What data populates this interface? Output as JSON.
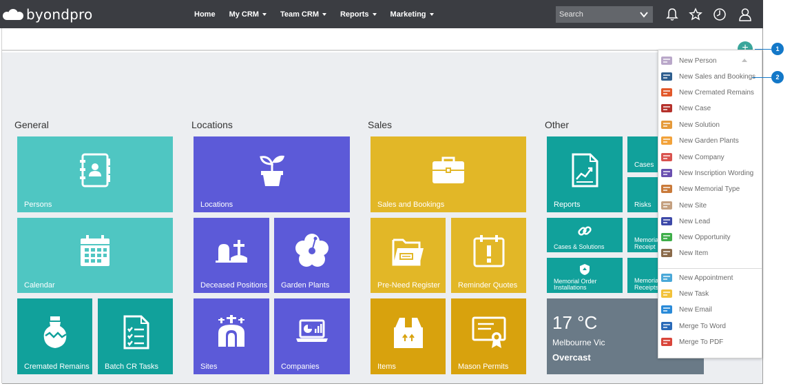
{
  "brand": {
    "name": "byondpro"
  },
  "nav": {
    "items": [
      {
        "label": "Home",
        "dropdown": false
      },
      {
        "label": "My CRM",
        "dropdown": true
      },
      {
        "label": "Team CRM",
        "dropdown": true
      },
      {
        "label": "Reports",
        "dropdown": true
      },
      {
        "label": "Marketing",
        "dropdown": true
      }
    ],
    "search_placeholder": "Search"
  },
  "groups": {
    "general": "General",
    "locations": "Locations",
    "sales": "Sales",
    "other": "Other"
  },
  "tiles": {
    "persons": "Persons",
    "calendar": "Calendar",
    "cremated_remains": "Cremated Remains",
    "batch_cr_tasks": "Batch CR Tasks",
    "locations": "Locations",
    "deceased_positions": "Deceased Positions",
    "garden_plants": "Garden Plants",
    "sites": "Sites",
    "companies": "Companies",
    "sales_bookings": "Sales and Bookings",
    "pre_need_register": "Pre-Need Register",
    "reminder_quotes": "Reminder Quotes",
    "items": "Items",
    "mason_permits": "Mason Permits",
    "reports": "Reports",
    "cases": "Cases",
    "risks": "Risks",
    "cases_solutions": "Cases & Solutions",
    "memorial_receipt_1": "Memorial Receipt",
    "memorial_order_line1": "Memorial Order",
    "memorial_order_line2": "Installations",
    "memorial_receipt_2": "Memorial Receipts"
  },
  "weather": {
    "temp": "17 °C",
    "city": "Melbourne Vic",
    "condition": "Overcast"
  },
  "add_button": {
    "label": "+"
  },
  "dropdown": {
    "items": [
      {
        "label": "New Person",
        "icon": "person-card-icon",
        "color": "#b9a7c9"
      },
      {
        "label": "New Sales and Bookings",
        "icon": "briefcase-icon",
        "color": "#2f5f8f"
      },
      {
        "label": "New Cremated Remains",
        "icon": "urn-icon",
        "color": "#e2582a"
      },
      {
        "label": "New Case",
        "icon": "case-binders-icon",
        "color": "#b5322c"
      },
      {
        "label": "New Solution",
        "icon": "solution-blocks-icon",
        "color": "#e59a3a"
      },
      {
        "label": "New Garden Plants",
        "icon": "flower-icon",
        "color": "#f2a23a"
      },
      {
        "label": "New Company",
        "icon": "company-card-icon",
        "color": "#d9534f"
      },
      {
        "label": "New Inscription Wording",
        "icon": "quote-icon",
        "color": "#6a4fb0"
      },
      {
        "label": "New Memorial Type",
        "icon": "memorial-icon",
        "color": "#c97a3a"
      },
      {
        "label": "New Site",
        "icon": "church-icon",
        "color": "#c4a080"
      },
      {
        "label": "New Lead",
        "icon": "lead-card-icon",
        "color": "#3d49a8"
      },
      {
        "label": "New Opportunity",
        "icon": "opportunity-icon",
        "color": "#3fae4a"
      },
      {
        "label": "New Item",
        "icon": "item-box-icon",
        "color": "#8a6a4a"
      },
      {
        "label": "New Appointment",
        "icon": "appointment-icon",
        "color": "#4aa8d8"
      },
      {
        "label": "New Task",
        "icon": "task-check-icon",
        "color": "#f2c23a"
      },
      {
        "label": "New Email",
        "icon": "email-icon",
        "color": "#2a8ad8"
      },
      {
        "label": "Merge To Word",
        "icon": "word-icon",
        "color": "#2a6ab8"
      },
      {
        "label": "Merge To PDF",
        "icon": "pdf-icon",
        "color": "#d9453a"
      }
    ]
  },
  "callouts": {
    "one": "1",
    "two": "2"
  }
}
